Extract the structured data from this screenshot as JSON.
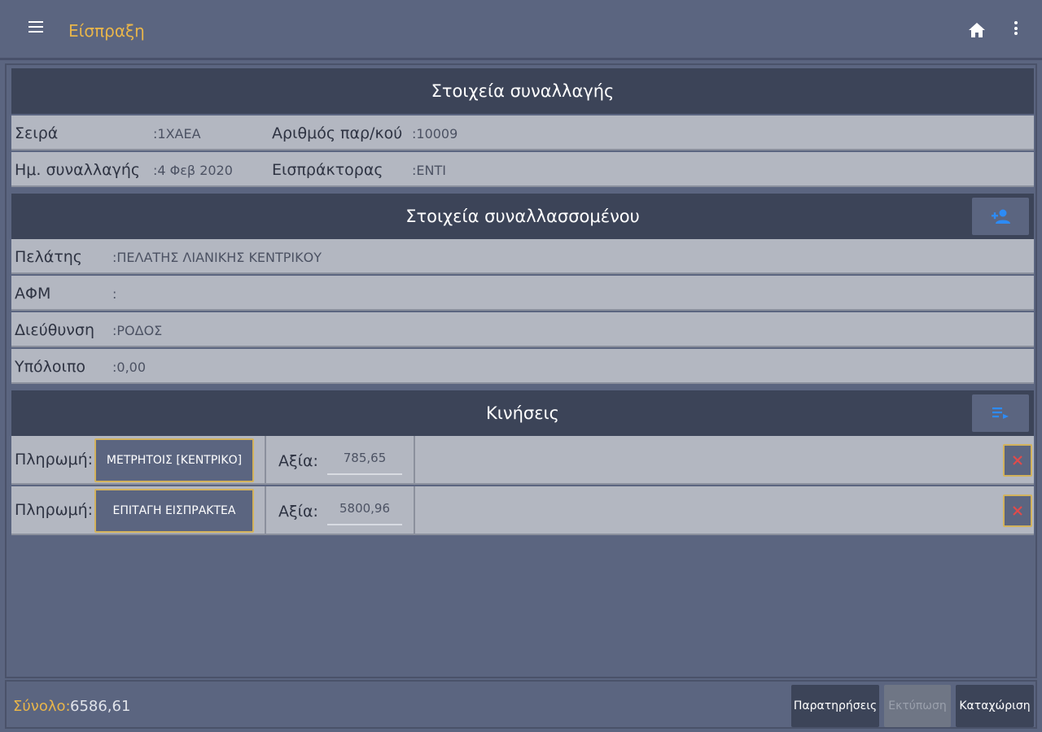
{
  "appbar": {
    "title": "Είσπραξη",
    "icons": [
      "menu-icon",
      "home-icon",
      "more-vert-icon"
    ]
  },
  "transaction": {
    "header": "Στοιχεία συναλλαγής",
    "series_label": "Σειρά",
    "series_value": ":1ΧΑΕΑ",
    "number_label": "Αριθμός παρ/κού",
    "number_value": ":10009",
    "date_label": "Ημ. συναλλαγής",
    "date_value": ":4 Φεβ 2020",
    "collector_label": "Εισπράκτορας",
    "collector_value": ":ΕΝΤΙ"
  },
  "customer": {
    "header": "Στοιχεία συναλλασσομένου",
    "add_icon": "person-add-icon",
    "client_label": "Πελάτης",
    "client_value": ":ΠΕΛΑΤΗΣ ΛΙΑΝΙΚΗΣ ΚΕΝΤΡΙΚΟΥ",
    "afm_label": "ΑΦΜ",
    "afm_value": ":",
    "address_label": "Διεύθυνση",
    "address_value": ":ΡΟΔΟΣ",
    "balance_label": "Υπόλοιπο",
    "balance_value": ":0,00"
  },
  "movements": {
    "header": "Κινήσεις",
    "add_icon": "playlist-add-icon",
    "payment_label": "Πληρωμή:",
    "value_label": "Αξία:",
    "rows": [
      {
        "method": "ΜΕΤΡΗΤΟΙΣ [ΚΕΝΤΡΙΚΟ]",
        "amount": "785,65"
      },
      {
        "method": "ΕΠΙΤΑΓΗ ΕΙΣΠΡΑΚΤΕΑ",
        "amount": "5800,96"
      }
    ]
  },
  "footer": {
    "total_label": "Σύνολο:",
    "total_value": "6586,61",
    "notes_button": "Παρατηρήσεις",
    "print_button": "Εκτύπωση",
    "save_button": "Καταχώριση"
  },
  "colors": {
    "background": "#5b6580",
    "header_dark": "#3c4458",
    "row_light": "#b3b7c1",
    "accent_gold": "#e8b54a",
    "delete_red": "#e04a4a",
    "icon_blue": "#2d8bf5"
  }
}
